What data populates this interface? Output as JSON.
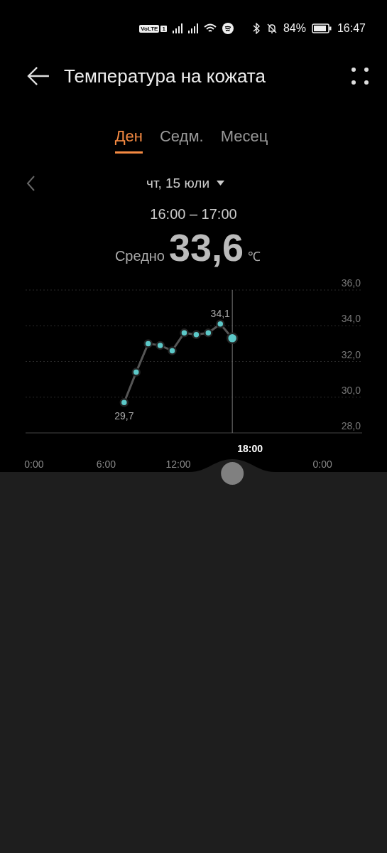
{
  "status_bar": {
    "volte": "VoLTE",
    "sim": "1",
    "battery": "84%",
    "time": "16:47"
  },
  "header": {
    "title": "Температура на кожата"
  },
  "tabs": [
    {
      "label": "Ден",
      "selected": true
    },
    {
      "label": "Седм.",
      "selected": false
    },
    {
      "label": "Месец",
      "selected": false
    }
  ],
  "date_picker": {
    "label": "чт, 15 юли"
  },
  "summary": {
    "range": "16:00 – 17:00",
    "prefix": "Средно",
    "value": "33,6",
    "unit": "℃"
  },
  "chart": {
    "chart_data": {
      "type": "line",
      "x": [
        7.5,
        8.5,
        9.5,
        10.5,
        11.5,
        12.5,
        13.5,
        14.5,
        15.5,
        16.5
      ],
      "xlim": [
        -0.7,
        27.3
      ],
      "ylim": [
        28,
        36
      ],
      "grid": true,
      "xticks": [
        {
          "value": 0,
          "label": "0:00"
        },
        {
          "value": 6,
          "label": "6:00"
        },
        {
          "value": 12,
          "label": "12:00"
        },
        {
          "value": 24,
          "label": "0:00"
        }
      ],
      "yticks": [
        {
          "value": 36,
          "label": "36,0"
        },
        {
          "value": 34,
          "label": "34,0"
        },
        {
          "value": 32,
          "label": "32,0"
        },
        {
          "value": 30,
          "label": "30,0"
        },
        {
          "value": 28,
          "label": "28,0"
        }
      ],
      "series": [
        {
          "color": "#5cc8c8",
          "marker": "circle",
          "values": [
            29.7,
            31.4,
            33.0,
            32.9,
            32.6,
            33.6,
            33.5,
            33.6,
            34.1,
            33.3
          ]
        }
      ],
      "value_labels": [
        "29,7",
        null,
        null,
        null,
        null,
        null,
        null,
        null,
        "34,1",
        null
      ],
      "ref_lines": [
        {
          "axis": "x",
          "value": 16.5
        }
      ]
    },
    "slider": {
      "label": "18:00"
    }
  }
}
